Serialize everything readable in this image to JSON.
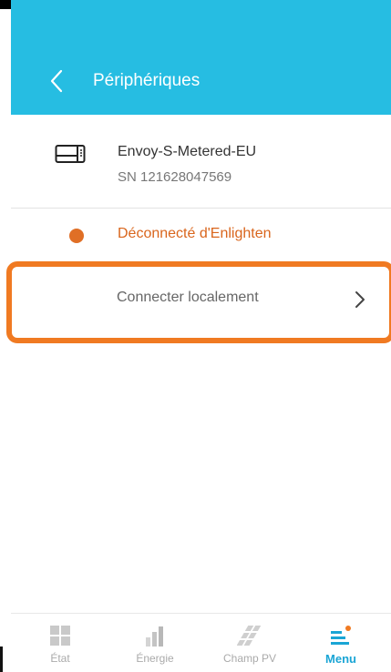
{
  "header": {
    "title": "Périphériques",
    "back_icon": "chevron-left-icon",
    "background": "#26bde2"
  },
  "device": {
    "icon": "gateway-device-icon",
    "name": "Envoy-S-Metered-EU",
    "serial": "SN 121628047569"
  },
  "status": {
    "icon": "status-dot-icon",
    "text": "Déconnecté d'Enlighten",
    "color": "#e06f26"
  },
  "connect": {
    "label": "Connecter localement",
    "icon": "chevron-right-icon",
    "highlight_color": "#f07a22"
  },
  "tabbar": {
    "tabs": [
      {
        "label": "État",
        "icon": "grid-icon",
        "active": false
      },
      {
        "label": "Énergie",
        "icon": "bar-chart-icon",
        "active": false
      },
      {
        "label": "Champ PV",
        "icon": "solar-panel-icon",
        "active": false
      },
      {
        "label": "Menu",
        "icon": "menu-icon",
        "active": true
      }
    ],
    "active_color": "#1aa5d5",
    "badge_color": "#f07a22"
  }
}
